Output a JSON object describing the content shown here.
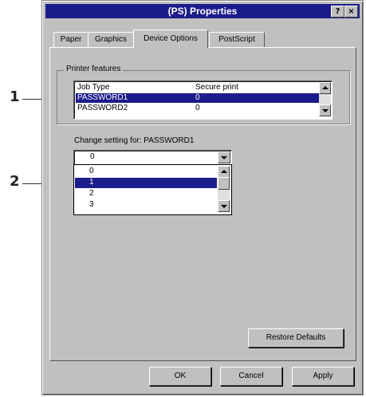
{
  "callouts": {
    "one": "1",
    "two": "2"
  },
  "window": {
    "title": "(PS) Properties",
    "help_glyph": "?",
    "close_glyph": "×"
  },
  "tabs": [
    {
      "label": "Paper"
    },
    {
      "label": "Graphics"
    },
    {
      "label": "Device Options"
    },
    {
      "label": "PostScript"
    }
  ],
  "active_tab": "Device Options",
  "printer_features": {
    "label": "Printer features",
    "header": {
      "col1": "Job Type",
      "col2": "Secure print"
    },
    "rows": [
      {
        "name": "PASSWORD1",
        "value": "0",
        "selected": true
      },
      {
        "name": "PASSWORD2",
        "value": "0",
        "selected": false
      }
    ]
  },
  "change_setting": {
    "label": "Change setting for: PASSWORD1",
    "current_value": "0",
    "options": [
      {
        "value": "0"
      },
      {
        "value": "1",
        "selected": true
      },
      {
        "value": "2"
      },
      {
        "value": "3"
      }
    ]
  },
  "buttons": {
    "restore": "Restore Defaults",
    "ok": "OK",
    "cancel": "Cancel",
    "apply": "Apply"
  }
}
